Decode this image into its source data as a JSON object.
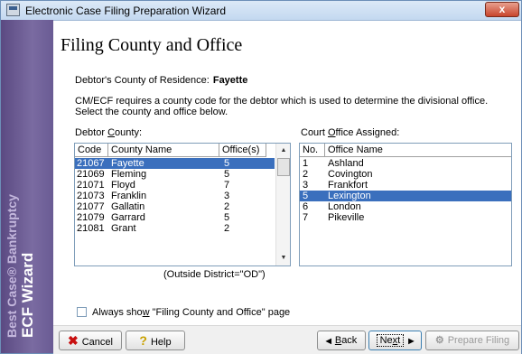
{
  "window": {
    "title": "Electronic Case Filing Preparation Wizard",
    "close_glyph": "x"
  },
  "sidebar": {
    "line1": "Best Case® Bankruptcy",
    "line2": "ECF Wizard"
  },
  "page": {
    "title": "Filing County and Office",
    "residence_label": "Debtor's County of Residence:",
    "residence_value": "Fayette",
    "description": "CM/ECF requires a county code for the debtor which is used to determine the divisional office. Select the county and office below.",
    "debtor_county_label_pre": "Debtor ",
    "debtor_county_label_ul": "C",
    "debtor_county_label_post": "ounty:",
    "office_label_pre": "Court ",
    "office_label_ul": "O",
    "office_label_post": "ffice Assigned:",
    "outside_note": "(Outside District=\"OD\")",
    "checkbox_label_pre": "Always sho",
    "checkbox_label_ul": "w",
    "checkbox_label_post": " \"Filing County and Office\" page",
    "checkbox_checked": false
  },
  "county_table": {
    "headers": [
      "Code",
      "County Name",
      "Office(s)"
    ],
    "rows": [
      {
        "code": "21067",
        "name": "Fayette",
        "office": "5",
        "selected": true
      },
      {
        "code": "21069",
        "name": "Fleming",
        "office": "5",
        "selected": false
      },
      {
        "code": "21071",
        "name": "Floyd",
        "office": "7",
        "selected": false
      },
      {
        "code": "21073",
        "name": "Franklin",
        "office": "3",
        "selected": false
      },
      {
        "code": "21077",
        "name": "Gallatin",
        "office": "2",
        "selected": false
      },
      {
        "code": "21079",
        "name": "Garrard",
        "office": "5",
        "selected": false
      },
      {
        "code": "21081",
        "name": "Grant",
        "office": "2",
        "selected": false
      }
    ]
  },
  "office_table": {
    "headers": [
      "No.",
      "Office Name"
    ],
    "rows": [
      {
        "no": "1",
        "name": "Ashland",
        "selected": false
      },
      {
        "no": "2",
        "name": "Covington",
        "selected": false
      },
      {
        "no": "3",
        "name": "Frankfort",
        "selected": false
      },
      {
        "no": "5",
        "name": "Lexington",
        "selected": true
      },
      {
        "no": "6",
        "name": "London",
        "selected": false
      },
      {
        "no": "7",
        "name": "Pikeville",
        "selected": false
      }
    ]
  },
  "buttons": {
    "cancel": "Cancel",
    "help": "Help",
    "back_pre": "",
    "back_ul": "B",
    "back_post": "ack",
    "next_pre": "Ne",
    "next_ul": "x",
    "next_post": "t",
    "prepare": "Prepare Filing"
  },
  "icons": {
    "cancel": "x-icon",
    "help": "question-icon",
    "back": "arrow-left-icon",
    "next": "arrow-right-icon",
    "prepare": "gear-icon"
  },
  "colors": {
    "sidebar": "#6a5b94",
    "selection": "#3a6fbd",
    "close": "#c8452c"
  }
}
